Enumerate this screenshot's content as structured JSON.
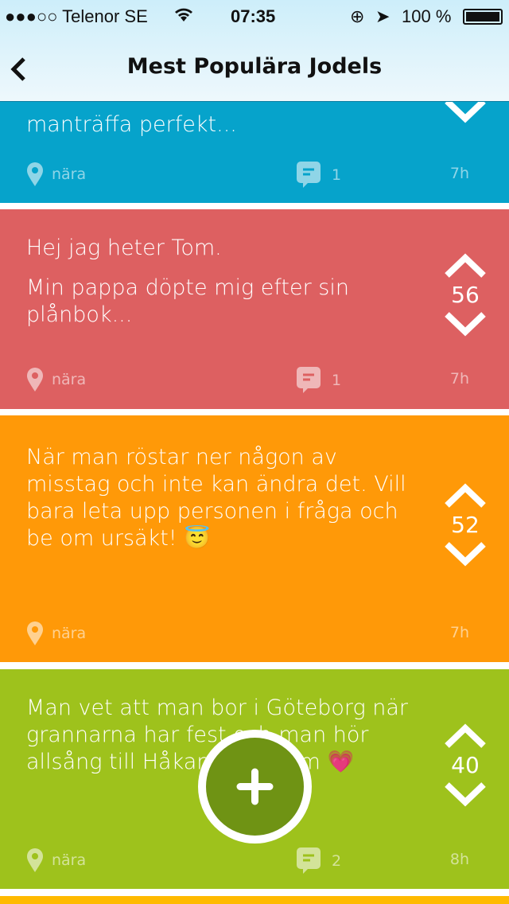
{
  "status_bar": {
    "carrier": "●●●○○ Telenor SE",
    "time": "07:35",
    "battery": "100 %"
  },
  "header": {
    "title": "Mest Populära Jodels",
    "back_label": "<"
  },
  "posts": [
    {
      "color": "#06a3cb",
      "lines": [
        "manträffa perfekt..."
      ],
      "score": "",
      "location": "nära",
      "comments": "1",
      "time": "7h"
    },
    {
      "color": "#dd6061",
      "lines": [
        "Hej jag heter Tom.",
        "Min pappa döpte mig efter sin plånbok..."
      ],
      "score": "56",
      "location": "nära",
      "comments": "1",
      "time": "7h"
    },
    {
      "color": "#ff9908",
      "lines": [
        "När man röstar ner någon av misstag och inte kan ändra det. Vill bara leta upp personen i fråga och be om ursäkt! 😇"
      ],
      "score": "52",
      "location": "nära",
      "comments": "",
      "time": "7h"
    },
    {
      "color": "#9ec21c",
      "lines": [
        "Man vet att man bor i Göteborg när grannarna har fest och man hör allsång till Håkan Hellström 💗"
      ],
      "score": "40",
      "location": "nära",
      "comments": "2",
      "time": "8h"
    }
  ],
  "next_post_color": "#ffba00"
}
